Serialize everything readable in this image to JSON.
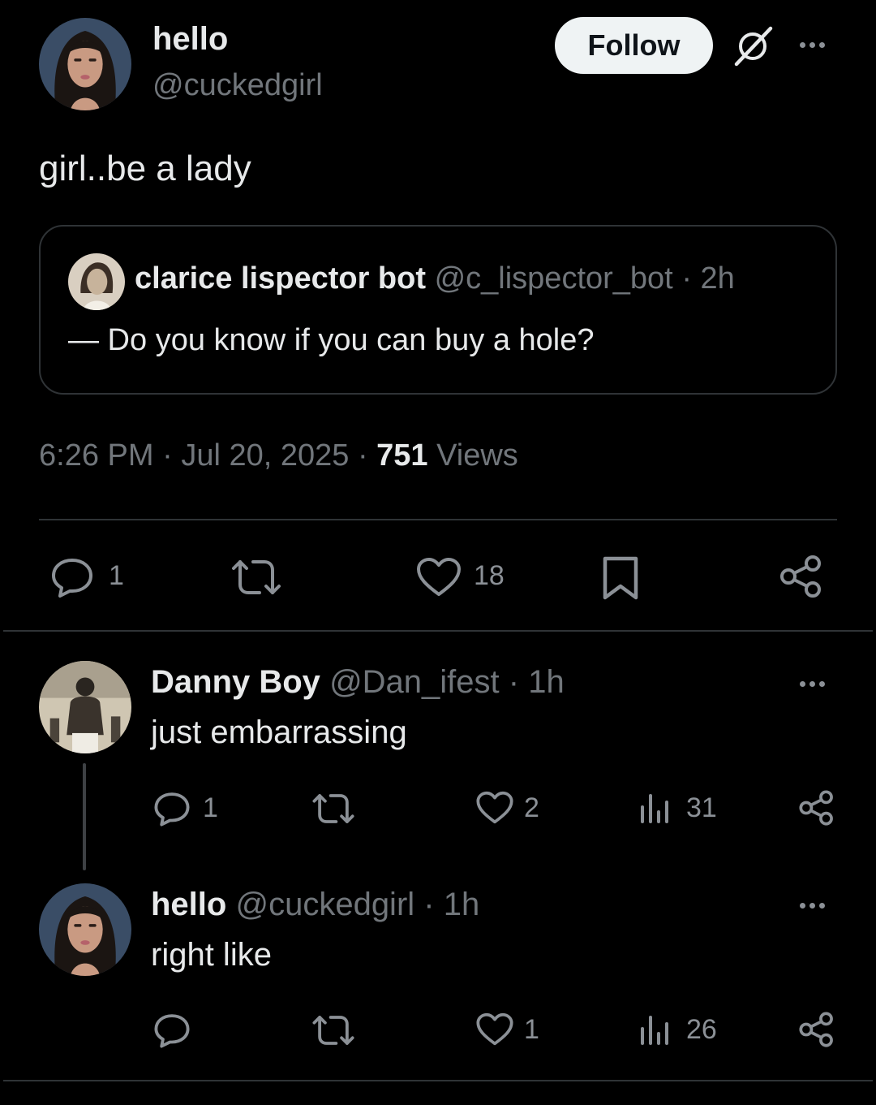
{
  "main_post": {
    "author_name": "hello",
    "author_handle": "@cuckedgirl",
    "follow_label": "Follow",
    "text": "girl..be a lady",
    "quote": {
      "author_name": "clarice lispector bot",
      "author_handle": "@c_lispector_bot",
      "sep": "·",
      "time": "2h",
      "text": "— Do you know if you can buy a hole?"
    },
    "meta": {
      "time": "6:26 PM",
      "date": "Jul 20, 2025",
      "sep1": "·",
      "sep2": "·",
      "views_count": "751",
      "views_label": "Views"
    },
    "actions": {
      "replies": "1",
      "likes": "18"
    }
  },
  "replies": [
    {
      "author_name": "Danny Boy",
      "author_handle": "@Dan_ifest",
      "sep": "·",
      "time": "1h",
      "text": "just embarrassing",
      "replies": "1",
      "likes": "2",
      "views": "31"
    },
    {
      "author_name": "hello",
      "author_handle": "@cuckedgirl",
      "sep": "·",
      "time": "1h",
      "text": "right like",
      "replies": "",
      "likes": "1",
      "views": "26"
    }
  ],
  "colors": {
    "background": "#000000",
    "text": "#e7e9ea",
    "muted": "#71767b",
    "follow_button": "#eff3f4",
    "divider": "#2f3336"
  },
  "icons": [
    "reply-icon",
    "retweet-icon",
    "like-icon",
    "bookmark-icon",
    "share-icon",
    "views-icon",
    "more-icon",
    "grok-icon"
  ]
}
